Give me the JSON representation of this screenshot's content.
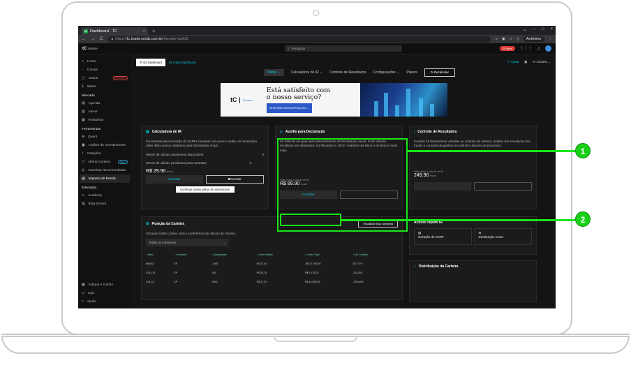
{
  "browser": {
    "tab_title": "Dashboard - TC",
    "tab_close": "×",
    "new_tab": "+",
    "nav": [
      "←",
      "→",
      "C"
    ],
    "url_prefix": "https://",
    "url_host": "tc.tradersclub.com.br",
    "url_path": "/income-tax/b3",
    "profile": "Anônimo",
    "window_controls": [
      "⌄",
      "–",
      "□",
      "×"
    ]
  },
  "app": {
    "logo": "tC",
    "logo_sub": "Master",
    "search_placeholder": "Pesquisar",
    "badge": "20 Beta",
    "user_label": "Usuário"
  },
  "sidebar": {
    "items": [
      {
        "icon": "⌂",
        "label": "Home"
      },
      {
        "icon": "◌",
        "label": "Canais"
      },
      {
        "icon": "▢",
        "label": "Status",
        "badge": "Em breve",
        "badge_color": "red"
      },
      {
        "icon": "§",
        "label": "Ideias"
      }
    ],
    "section_market": "Mercado",
    "market_items": [
      {
        "icon": "▤",
        "label": "Agenda"
      },
      {
        "icon": "▥",
        "label": "Ativos"
      },
      {
        "icon": "▦",
        "label": "Relatórios"
      }
    ],
    "section_tools": "Ferramentas",
    "tool_items": [
      {
        "icon": "⊛",
        "label": "Quant"
      },
      {
        "icon": "▣",
        "label": "Análise de Investimentos"
      },
      {
        "icon": "⌇",
        "label": "Cotações"
      },
      {
        "icon": "▢",
        "label": "Minha Carteira",
        "badge": "Novo",
        "badge_color": "teal"
      },
      {
        "icon": "◎",
        "label": "Carteiras Recomendadas"
      },
      {
        "icon": "▤",
        "label": "Imposto de Renda",
        "active": true
      }
    ],
    "section_edu": "Educação",
    "edu_items": [
      {
        "icon": "⊂",
        "label": "Academy"
      },
      {
        "icon": "▤",
        "label": "Blog School"
      }
    ],
    "bottom_items": [
      {
        "icon": "▦",
        "label": "Indique e Ganhe"
      },
      {
        "icon": "⊔",
        "label": "Loja"
      },
      {
        "icon": "?",
        "label": "Ajuda"
      }
    ]
  },
  "subtabs": {
    "active": "IR B3 Dashboard",
    "other": "IR Cripto Dashboard"
  },
  "subtop": {
    "help": "Ajuda",
    "user": "Usuário"
  },
  "menu": {
    "selected": "Notas",
    "items": [
      "Calculadora de IR",
      "Controle de Resultados",
      "Configurações",
      "Planos"
    ],
    "reset": "Recalcular"
  },
  "banner": {
    "brand_sub": "Tesouro",
    "headline_1": "Está satisfeito com",
    "headline_2": "o nosso serviço?",
    "cta": "RESPONDA NOSSA PESQUISA →"
  },
  "cards": {
    "calc": {
      "title": "Calculadora de IR",
      "desc": "Ferramenta para Geração do DARFs mensais com juros e multa, se necessário. Além disso possui relatórios para Declaração Anual.",
      "row1_label": "Meses de cálculo atualmente disponíveis:",
      "row1_value": "0",
      "row2_label": "Meses de cálculo pendentes para contratar:",
      "row2_value": "3",
      "price": "R$ 29.90",
      "price_unit": "anual",
      "btn_contract": "Contratar",
      "btn_access": "Acessar",
      "btn_plans": "Conheça nosso plano de assinatura!"
    },
    "decl": {
      "title": "Auxílio para Declaração",
      "desc": "Se trata de um guia para preenchimento da Declaração Anual. Inclui valores recebidos em dividendos, bonificações e JSCP, relatórios de Bens e Direitos e muito mais.",
      "note": "*Não inclui o cálculo de IR",
      "price": "R$ 89.90",
      "price_unit": "anual",
      "btn_contract": "Contratar"
    },
    "results": {
      "title": "Controle de Resultados",
      "desc": "Contém 10 ferramentas voltadas ao controle de carteira, análise dos resultados dos trades e consulta de ganhos em dinheiro através de proventos.",
      "note": "*Não inclui o cálculo de IR",
      "price": "249.90",
      "price_unit": "anual"
    },
    "position": {
      "title": "Posição da Carteira",
      "btn": "Visualizar lista completa",
      "hint": "Clicando sobre o ativo, será a conferência de cálculo do mesmo.",
      "select": "Todas as corretoras",
      "columns": [
        "↕ Ativo",
        "↕ Corretora",
        "↕ Quantidade",
        "↕ Custo Médio",
        "↕ Custo Total",
        "↕ Val Carteira"
      ],
      "rows": [
        [
          "BBAS3",
          "XP",
          "-1000",
          "R$ 27,40",
          "-R$ 27.395,00",
          "187,77%"
        ],
        [
          "COLL15",
          "XP",
          "105",
          "R$ 24,15",
          "R$ 6.176,22",
          "-35,02%"
        ],
        [
          "COLLA",
          "XP",
          "1000",
          "R$ 27,20",
          "R$ 10.538,00",
          "-200,46%"
        ]
      ]
    },
    "quick": {
      "title": "Acesso rápido IR",
      "item1": "Geração de DARF",
      "item2": "Declaração Anual"
    },
    "dist": {
      "title": "Distribuição da Carteira"
    }
  },
  "callouts": {
    "one": "1",
    "two": "2"
  },
  "colors": {
    "accent": "#00ccdd",
    "highlight": "#19e619",
    "callout": "#19d119"
  }
}
